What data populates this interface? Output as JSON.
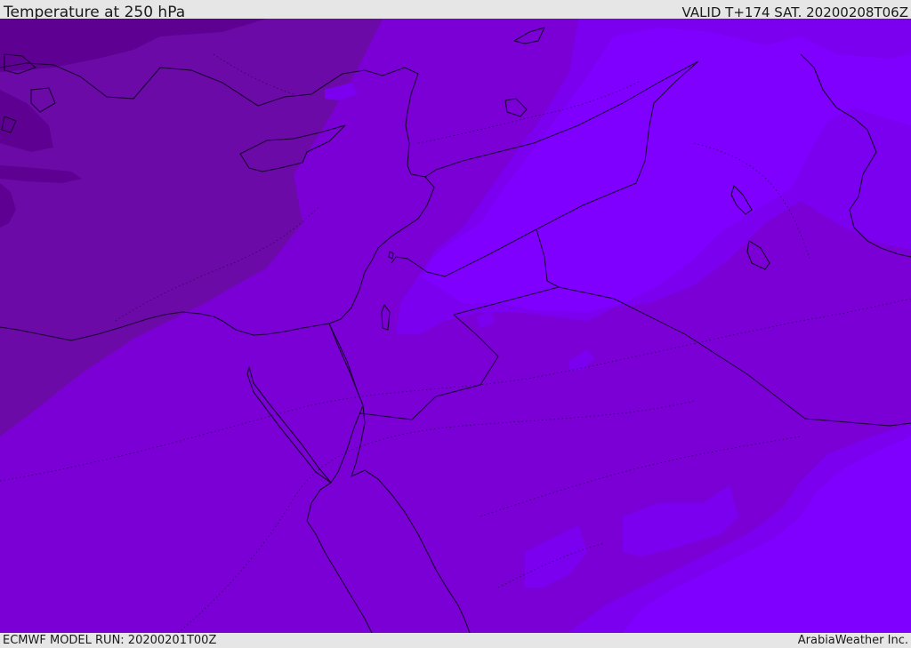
{
  "header": {
    "title": "Temperature at 250 hPa",
    "valid_time": "VALID T+174 SAT. 20200208T06Z"
  },
  "footer": {
    "model_run": "ECMWF MODEL RUN: 20200201T00Z",
    "credit": "ArabiaWeather Inc."
  },
  "colors": {
    "darkest": "#5e0092",
    "darker": "#6c0aa8",
    "mid_dark": "#7407bc",
    "mid": "#7a00d6",
    "light": "#7b00f0",
    "lightest": "#7f00ff",
    "coast": "#1a0033",
    "border": "#1a0033"
  }
}
